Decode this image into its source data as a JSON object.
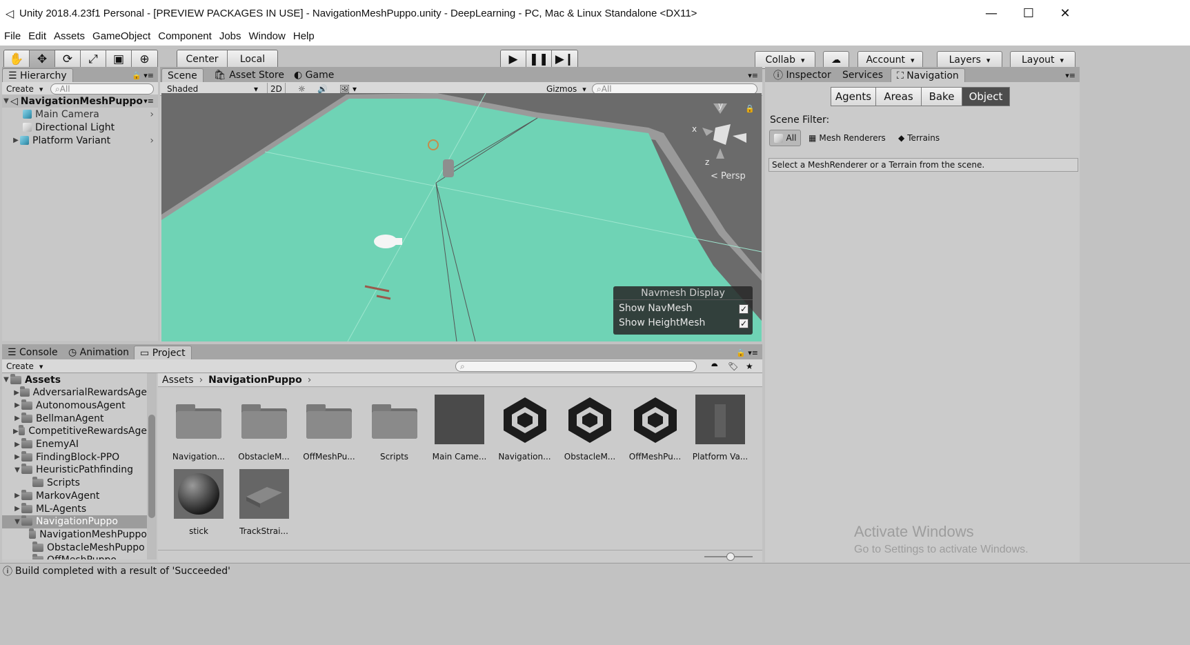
{
  "window": {
    "title": "Unity 2018.4.23f1 Personal - [PREVIEW PACKAGES IN USE] - NavigationMeshPuppo.unity - DeepLearning - PC, Mac & Linux Standalone <DX11>",
    "minimize": "—",
    "maximize": "☐",
    "close": "✕"
  },
  "menu": [
    "File",
    "Edit",
    "Assets",
    "GameObject",
    "Component",
    "Jobs",
    "Window",
    "Help"
  ],
  "toolbar": {
    "pivot_center": "Center",
    "pivot_local": "Local",
    "collab": "Collab",
    "account": "Account",
    "layers": "Layers",
    "layout": "Layout",
    "transform_tools": [
      "hand-icon",
      "move-icon",
      "rotate-icon",
      "scale-icon",
      "rect-icon",
      "transform-icon"
    ],
    "play_controls": [
      "play-icon",
      "pause-icon",
      "step-icon"
    ]
  },
  "hierarchy": {
    "tab": "Hierarchy",
    "create": "Create",
    "search_placeholder": "All",
    "scene": "NavigationMeshPuppo",
    "items": [
      "Main Camera",
      "Directional Light",
      "Platform Variant"
    ]
  },
  "scene": {
    "tabs": [
      "Scene",
      "Asset Store",
      "Game"
    ],
    "shading": "Shaded",
    "mode_2d": "2D",
    "gizmos": "Gizmos",
    "search_placeholder": "All",
    "persp": "Persp",
    "axis": {
      "x": "x",
      "y": "y",
      "z": "z"
    },
    "navmesh_display": {
      "title": "Navmesh Display",
      "show_navmesh": "Show NavMesh",
      "show_heightmesh": "Show HeightMesh",
      "check": "✓"
    }
  },
  "inspector": {
    "tabs": [
      "Inspector",
      "Services",
      "Navigation"
    ],
    "nav_tabs": [
      "Agents",
      "Areas",
      "Bake",
      "Object"
    ],
    "scene_filter_label": "Scene Filter:",
    "filters": [
      "All",
      "Mesh Renderers",
      "Terrains"
    ],
    "hint": "Select a MeshRenderer or a Terrain from the scene."
  },
  "bottom": {
    "tabs": [
      "Console",
      "Animation",
      "Project"
    ],
    "create": "Create",
    "breadcrumb": [
      "Assets",
      "NavigationPuppo"
    ],
    "tree": [
      {
        "label": "Assets",
        "level": 0,
        "arrow": "▼"
      },
      {
        "label": "AdversarialRewardsAge",
        "level": 1,
        "arrow": "▶"
      },
      {
        "label": "AutonomousAgent",
        "level": 1,
        "arrow": "▶"
      },
      {
        "label": "BellmanAgent",
        "level": 1,
        "arrow": "▶"
      },
      {
        "label": "CompetitiveRewardsAge",
        "level": 1,
        "arrow": "▶"
      },
      {
        "label": "EnemyAI",
        "level": 1,
        "arrow": "▶"
      },
      {
        "label": "FindingBlock-PPO",
        "level": 1,
        "arrow": "▶"
      },
      {
        "label": "HeuristicPathfinding",
        "level": 1,
        "arrow": "▼"
      },
      {
        "label": "Scripts",
        "level": 2,
        "arrow": ""
      },
      {
        "label": "MarkovAgent",
        "level": 1,
        "arrow": "▶"
      },
      {
        "label": "ML-Agents",
        "level": 1,
        "arrow": "▶"
      },
      {
        "label": "NavigationPuppo",
        "level": 1,
        "arrow": "▼"
      },
      {
        "label": "NavigationMeshPuppo",
        "level": 2,
        "arrow": ""
      },
      {
        "label": "ObstacleMeshPuppo",
        "level": 2,
        "arrow": ""
      },
      {
        "label": "OffMeshPuppo",
        "level": 2,
        "arrow": ""
      }
    ],
    "assets": [
      {
        "label": "Navigation...",
        "kind": "folder"
      },
      {
        "label": "ObstacleM...",
        "kind": "folder"
      },
      {
        "label": "OffMeshPu...",
        "kind": "folder"
      },
      {
        "label": "Scripts",
        "kind": "folder"
      },
      {
        "label": "Main Came...",
        "kind": "prefab-dark"
      },
      {
        "label": "Navigation...",
        "kind": "unity"
      },
      {
        "label": "ObstacleM...",
        "kind": "unity"
      },
      {
        "label": "OffMeshPu...",
        "kind": "unity"
      },
      {
        "label": "Platform Va...",
        "kind": "prefab-door"
      },
      {
        "label": "stick",
        "kind": "sphere"
      },
      {
        "label": "TrackStrai...",
        "kind": "track"
      }
    ]
  },
  "status": "Build completed with a result of 'Succeeded'",
  "watermark": {
    "line1": "Activate Windows",
    "line2": "Go to Settings to activate Windows."
  },
  "colors": {
    "navmesh": "#6fd3b5",
    "editor_bg": "#c2c2c2",
    "scene_bg": "#6d6d6d"
  }
}
